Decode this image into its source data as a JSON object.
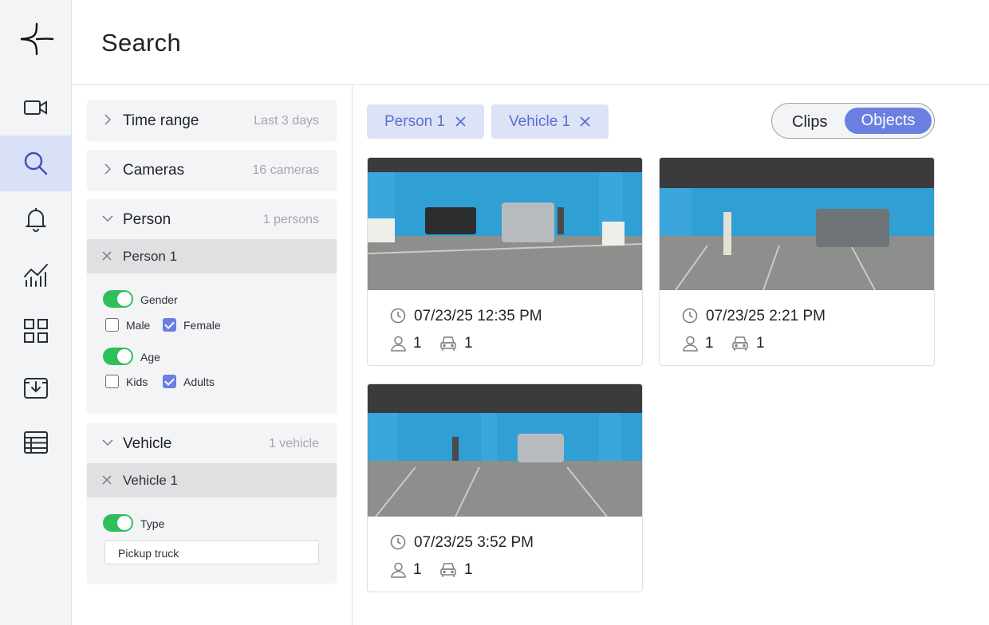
{
  "page": {
    "title": "Search"
  },
  "nav": {
    "items": [
      {
        "icon": "video-camera-icon",
        "active": false
      },
      {
        "icon": "search-icon",
        "active": true
      },
      {
        "icon": "bell-icon",
        "active": false
      },
      {
        "icon": "analytics-icon",
        "active": false
      },
      {
        "icon": "grid-icon",
        "active": false
      },
      {
        "icon": "download-tray-icon",
        "active": false
      },
      {
        "icon": "table-icon",
        "active": false
      }
    ]
  },
  "filters": {
    "time_range": {
      "label": "Time range",
      "value": "Last 3 days"
    },
    "cameras": {
      "label": "Cameras",
      "value": "16 cameras"
    },
    "person": {
      "label": "Person",
      "count": "1 persons",
      "entry": "Person 1",
      "gender": {
        "label": "Gender",
        "enabled": true,
        "options": [
          {
            "label": "Male",
            "checked": false
          },
          {
            "label": "Female",
            "checked": true
          }
        ]
      },
      "age": {
        "label": "Age",
        "enabled": true,
        "options": [
          {
            "label": "Kids",
            "checked": false
          },
          {
            "label": "Adults",
            "checked": true
          }
        ]
      }
    },
    "vehicle": {
      "label": "Vehicle",
      "count": "1 vehicle",
      "entry": "Vehicle 1",
      "type": {
        "label": "Type",
        "enabled": true,
        "value": "Pickup truck"
      }
    }
  },
  "chips": [
    {
      "label": "Person 1"
    },
    {
      "label": "Vehicle 1"
    }
  ],
  "view_toggle": {
    "options": [
      "Clips",
      "Objects"
    ],
    "selected": "Objects"
  },
  "results": [
    {
      "timestamp": "07/23/25 12:35 PM",
      "persons": "1",
      "vehicles": "1"
    },
    {
      "timestamp": "07/23/25 2:21 PM",
      "persons": "1",
      "vehicles": "1"
    },
    {
      "timestamp": "07/23/25 3:52 PM",
      "persons": "1",
      "vehicles": "1"
    }
  ],
  "colors": {
    "accent": "#6a7fe0",
    "chip_bg": "#dce3f7",
    "toggle_on": "#2fbf5a",
    "nav_active_bg": "#d9e0f7"
  }
}
